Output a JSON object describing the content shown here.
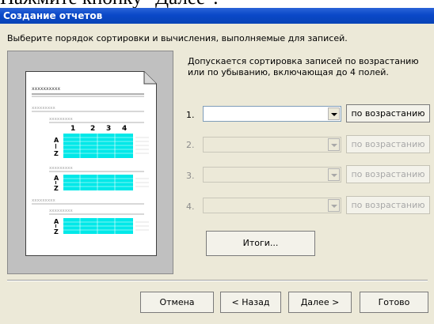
{
  "document": {
    "caption": "Нажмите кнопку \"Далее\"."
  },
  "window": {
    "title": "Создание отчетов"
  },
  "subtitle": "Выберите порядок сортировки и вычисления, выполняемые для записей.",
  "hint": "Допускается сортировка записей по возрастанию или по убыванию, включающая до 4 полей.",
  "sort_rows": [
    {
      "number": "1.",
      "field_value": "",
      "order_label": "по возрастанию",
      "enabled": true
    },
    {
      "number": "2.",
      "field_value": "",
      "order_label": "по возрастанию",
      "enabled": false
    },
    {
      "number": "3.",
      "field_value": "",
      "order_label": "по возрастанию",
      "enabled": false
    },
    {
      "number": "4.",
      "field_value": "",
      "order_label": "по возрастанию",
      "enabled": false
    }
  ],
  "totals_button": "Итоги...",
  "buttons": {
    "cancel": "Отмена",
    "back": "< Назад",
    "next": "Далее >",
    "finish": "Готово"
  },
  "preview": {
    "title_text": "xxxxxxxxxx",
    "group_text": "xxxxxxxxx",
    "column_numbers": [
      "1",
      "2",
      "3",
      "4"
    ],
    "cell_text": "xxxx",
    "sort_letters": [
      "A",
      "Z"
    ]
  },
  "colors": {
    "title_bar": "#0a48c8",
    "highlight_cells": "#00e8e8",
    "dialog_bg": "#ece9d8"
  }
}
